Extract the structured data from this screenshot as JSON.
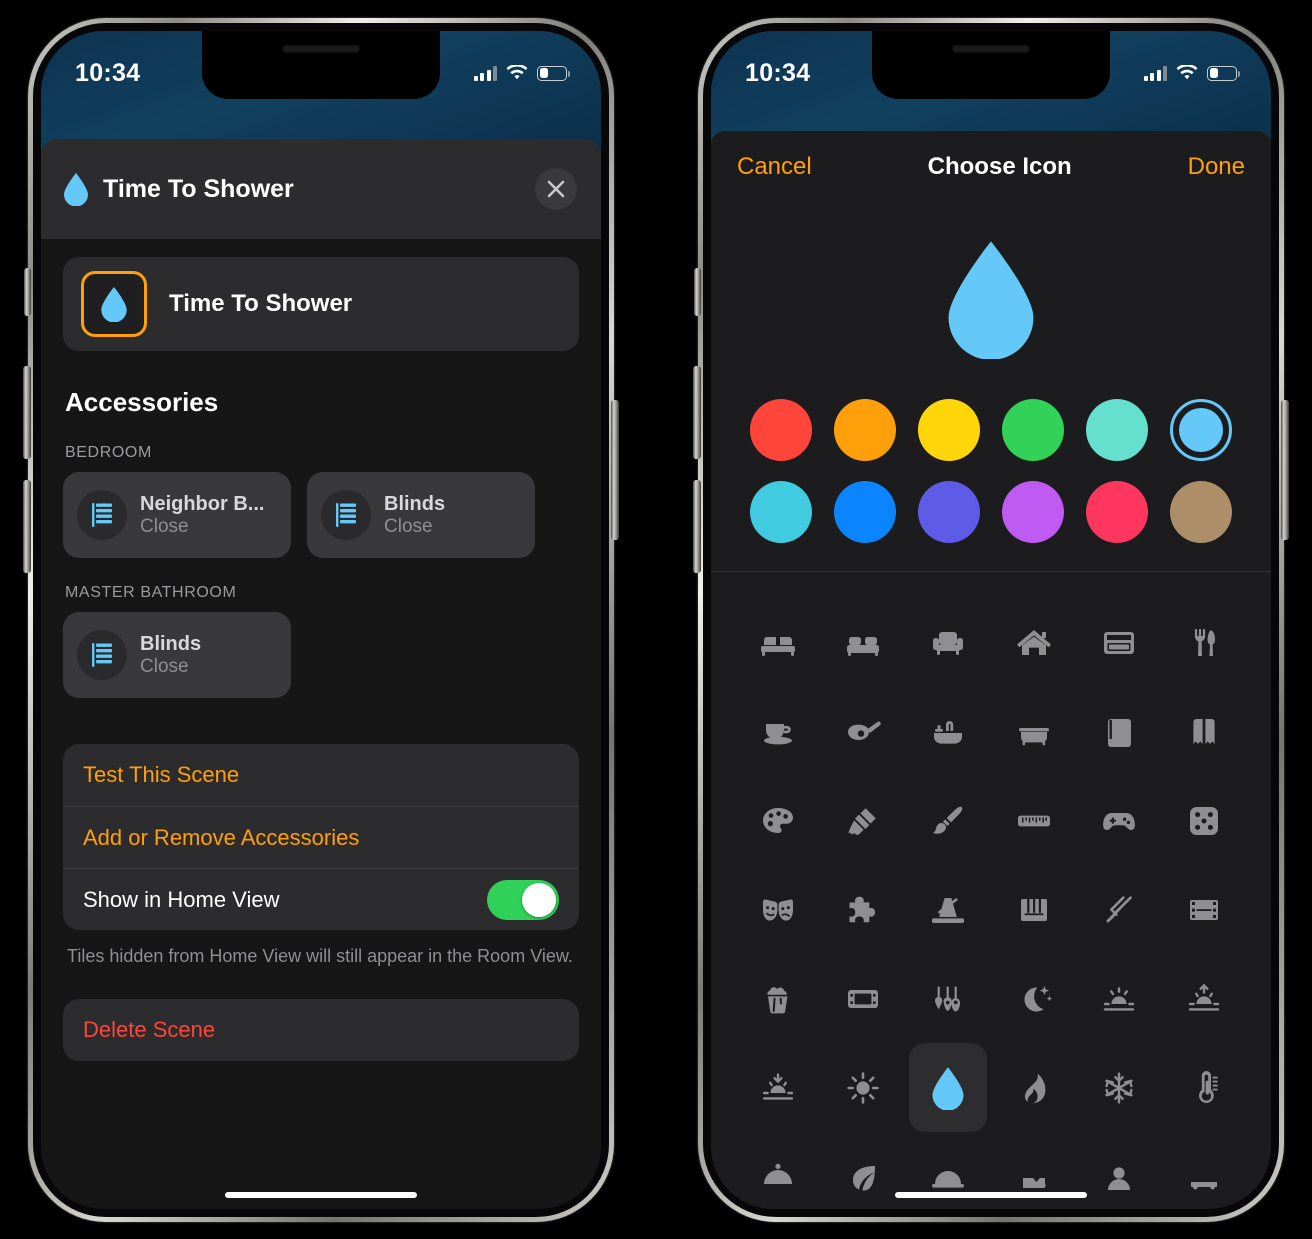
{
  "status_bar": {
    "time": "10:34",
    "signal_icon": "cellular-bars-icon",
    "wifi_icon": "wifi-icon",
    "battery_icon": "battery-icon"
  },
  "left_phone": {
    "sheet": {
      "title": "Time To Shower",
      "title_icon": "water-drop-icon",
      "close_icon": "close-icon",
      "name_field": {
        "value": "Time To Shower",
        "icon": "water-drop-icon"
      },
      "section_title": "Accessories",
      "rooms": [
        {
          "label": "BEDROOM",
          "accessories": [
            {
              "name": "Neighbor B...",
              "state": "Close",
              "icon": "blinds-icon"
            },
            {
              "name": "Blinds",
              "state": "Close",
              "icon": "blinds-icon"
            }
          ]
        },
        {
          "label": "MASTER BATHROOM",
          "accessories": [
            {
              "name": "Blinds",
              "state": "Close",
              "icon": "blinds-icon"
            }
          ]
        }
      ],
      "actions": [
        {
          "label": "Test This Scene",
          "style": "orange",
          "control": "none"
        },
        {
          "label": "Add or Remove Accessories",
          "style": "orange",
          "control": "none"
        },
        {
          "label": "Show in Home View",
          "style": "white",
          "control": "toggle",
          "toggle_on": true
        }
      ],
      "footnote": "Tiles hidden from Home View will still appear in the Room View.",
      "delete_label": "Delete Scene"
    }
  },
  "right_phone": {
    "picker": {
      "cancel_label": "Cancel",
      "title": "Choose Icon",
      "done_label": "Done",
      "preview_icon": "water-drop-icon",
      "preview_color": "#64c8f8",
      "colors": [
        {
          "name": "red",
          "hex": "#ff453a",
          "selected": false
        },
        {
          "name": "orange",
          "hex": "#ff9f0a",
          "selected": false
        },
        {
          "name": "yellow",
          "hex": "#ffd60a",
          "selected": false
        },
        {
          "name": "green",
          "hex": "#32d158",
          "selected": false
        },
        {
          "name": "mint",
          "hex": "#66e0ce",
          "selected": false
        },
        {
          "name": "light-blue",
          "hex": "#64c8f8",
          "selected": true
        },
        {
          "name": "cyan",
          "hex": "#40cbe0",
          "selected": false
        },
        {
          "name": "blue",
          "hex": "#0a84ff",
          "selected": false
        },
        {
          "name": "indigo",
          "hex": "#5e5ce6",
          "selected": false
        },
        {
          "name": "purple",
          "hex": "#bf5af2",
          "selected": false
        },
        {
          "name": "pink",
          "hex": "#ff375f",
          "selected": false
        },
        {
          "name": "brown",
          "hex": "#ac8e68",
          "selected": false
        }
      ],
      "icons": [
        {
          "name": "bed-icon",
          "selected": false
        },
        {
          "name": "sofa-icon",
          "selected": false
        },
        {
          "name": "armchair-icon",
          "selected": false
        },
        {
          "name": "house-icon",
          "selected": false
        },
        {
          "name": "oven-icon",
          "selected": false
        },
        {
          "name": "fork-knife-icon",
          "selected": false
        },
        {
          "name": "coffee-cup-icon",
          "selected": false
        },
        {
          "name": "frying-pan-icon",
          "selected": false
        },
        {
          "name": "sink-icon",
          "selected": false
        },
        {
          "name": "bathtub-icon",
          "selected": false
        },
        {
          "name": "book-closed-icon",
          "selected": false
        },
        {
          "name": "book-open-icon",
          "selected": false
        },
        {
          "name": "paint-palette-icon",
          "selected": false
        },
        {
          "name": "paint-brush-wide-icon",
          "selected": false
        },
        {
          "name": "paintbrush-icon",
          "selected": false
        },
        {
          "name": "ruler-icon",
          "selected": false
        },
        {
          "name": "game-controller-icon",
          "selected": false
        },
        {
          "name": "dice-icon",
          "selected": false
        },
        {
          "name": "theater-masks-icon",
          "selected": false
        },
        {
          "name": "puzzle-piece-icon",
          "selected": false
        },
        {
          "name": "metronome-icon",
          "selected": false
        },
        {
          "name": "piano-keys-icon",
          "selected": false
        },
        {
          "name": "tuning-fork-icon",
          "selected": false
        },
        {
          "name": "film-strip-icon",
          "selected": false
        },
        {
          "name": "popcorn-icon",
          "selected": false
        },
        {
          "name": "film-frame-icon",
          "selected": false
        },
        {
          "name": "guitars-icon",
          "selected": false
        },
        {
          "name": "moon-stars-icon",
          "selected": false
        },
        {
          "name": "sunset-icon",
          "selected": false
        },
        {
          "name": "sunrise-icon",
          "selected": false
        },
        {
          "name": "sun-dusk-icon",
          "selected": false
        },
        {
          "name": "sun-max-icon",
          "selected": false
        },
        {
          "name": "water-drop-icon",
          "selected": true
        },
        {
          "name": "flame-icon",
          "selected": false
        },
        {
          "name": "snowflake-icon",
          "selected": false
        },
        {
          "name": "thermometer-icon",
          "selected": false
        },
        {
          "name": "cloche-icon",
          "selected": false
        },
        {
          "name": "leaf-icon",
          "selected": false
        },
        {
          "name": "dome-icon",
          "selected": false
        },
        {
          "name": "pet-icon",
          "selected": false
        },
        {
          "name": "person-icon",
          "selected": false
        },
        {
          "name": "car-icon",
          "selected": false
        }
      ]
    }
  }
}
